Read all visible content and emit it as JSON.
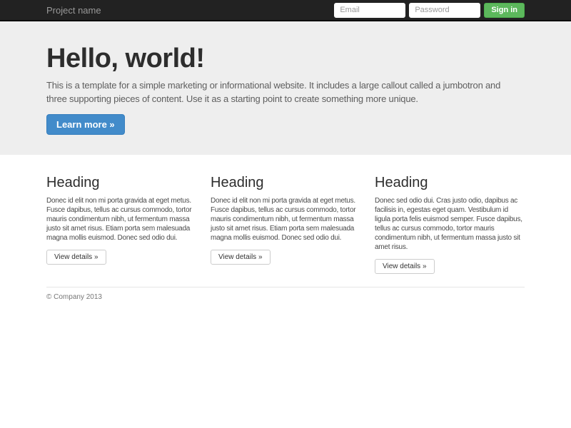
{
  "navbar": {
    "brand": "Project name",
    "email_placeholder": "Email",
    "password_placeholder": "Password",
    "sign_in_label": "Sign in"
  },
  "jumbotron": {
    "title": "Hello, world!",
    "description": "This is a template for a simple marketing or informational website. It includes a large callout called a jumbotron and three supporting pieces of content. Use it as a starting point to create something more unique.",
    "cta_label": "Learn more »"
  },
  "columns": [
    {
      "heading": "Heading",
      "body": "Donec id elit non mi porta gravida at eget metus. Fusce dapibus, tellus ac cursus commodo, tortor mauris condimentum nibh, ut fermentum massa justo sit amet risus. Etiam porta sem malesuada magna mollis euismod. Donec sed odio dui.",
      "button_label": "View details »"
    },
    {
      "heading": "Heading",
      "body": "Donec id elit non mi porta gravida at eget metus. Fusce dapibus, tellus ac cursus commodo, tortor mauris condimentum nibh, ut fermentum massa justo sit amet risus. Etiam porta sem malesuada magna mollis euismod. Donec sed odio dui.",
      "button_label": "View details »"
    },
    {
      "heading": "Heading",
      "body": "Donec sed odio dui. Cras justo odio, dapibus ac facilisis in, egestas eget quam. Vestibulum id ligula porta felis euismod semper. Fusce dapibus, tellus ac cursus commodo, tortor mauris condimentum nibh, ut fermentum massa justo sit amet risus.",
      "button_label": "View details »"
    }
  ],
  "footer": {
    "copyright": "© Company 2013"
  },
  "colors": {
    "navbar_bg": "#222222",
    "jumbotron_bg": "#eeeeee",
    "primary": "#428bca",
    "primary_border": "#357ebd",
    "success": "#5cb85c",
    "success_border": "#4cae4c"
  }
}
